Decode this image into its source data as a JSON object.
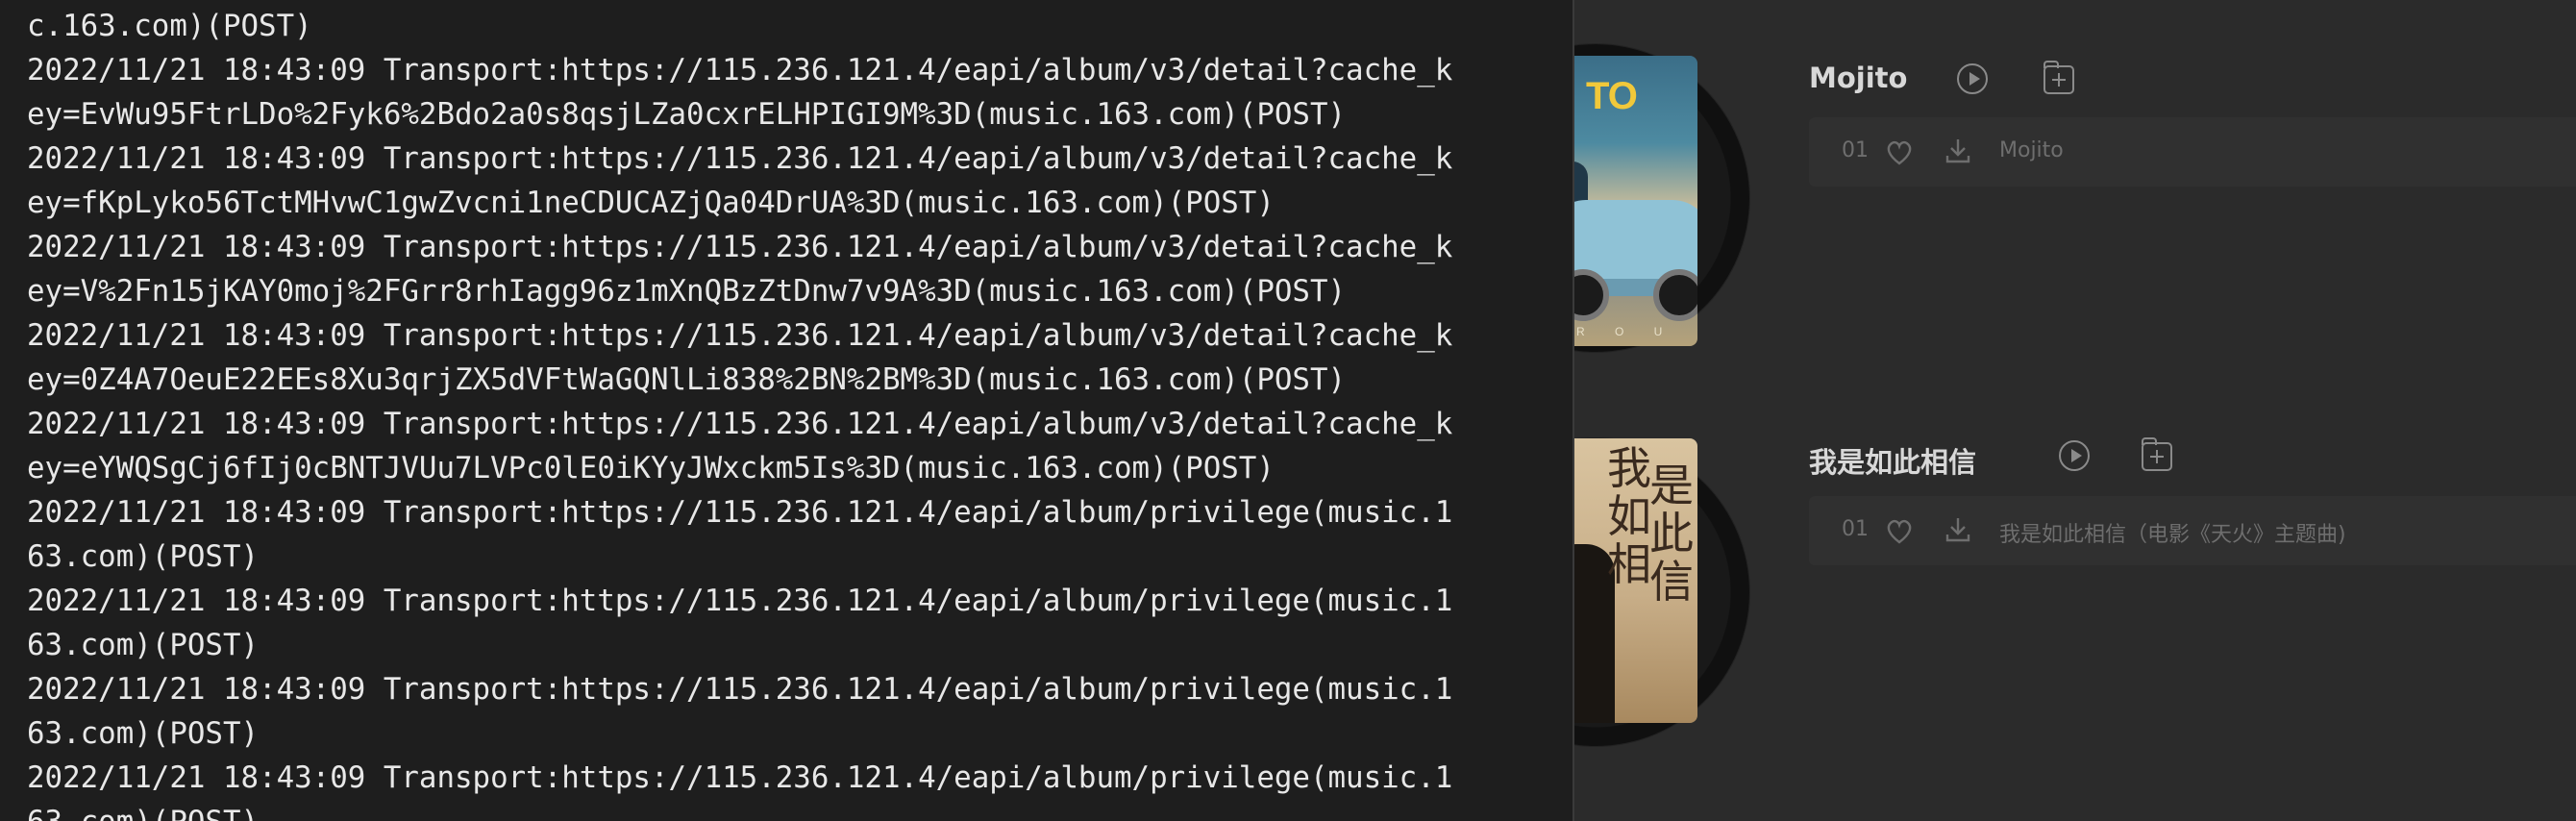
{
  "terminal": {
    "lines": [
      "c.163.com)(POST)",
      "2022/11/21 18:43:09 Transport:https://115.236.121.4/eapi/album/v3/detail?cache_k",
      "ey=EvWu95FtrLDo%2Fyk6%2Bdo2a0s8qsjLZa0cxrELHPIGI9M%3D(music.163.com)(POST)",
      "2022/11/21 18:43:09 Transport:https://115.236.121.4/eapi/album/v3/detail?cache_k",
      "ey=fKpLyko56TctMHvwC1gwZvcni1neCDUCAZjQa04DrUA%3D(music.163.com)(POST)",
      "2022/11/21 18:43:09 Transport:https://115.236.121.4/eapi/album/v3/detail?cache_k",
      "ey=V%2Fn15jKAY0moj%2FGrr8rhIagg96z1mXnQBzZtDnw7v9A%3D(music.163.com)(POST)",
      "2022/11/21 18:43:09 Transport:https://115.236.121.4/eapi/album/v3/detail?cache_k",
      "ey=0Z4A7OeuE22EEs8Xu3qrjZX5dVFtWaGQNlLi838%2BN%2BM%3D(music.163.com)(POST)",
      "2022/11/21 18:43:09 Transport:https://115.236.121.4/eapi/album/v3/detail?cache_k",
      "ey=eYWQSgCj6fIj0cBNTJVUu7LVPc0lE0iKYyJWxckm5Is%3D(music.163.com)(POST)",
      "2022/11/21 18:43:09 Transport:https://115.236.121.4/eapi/album/privilege(music.1",
      "63.com)(POST)",
      "2022/11/21 18:43:09 Transport:https://115.236.121.4/eapi/album/privilege(music.1",
      "63.com)(POST)",
      "2022/11/21 18:43:09 Transport:https://115.236.121.4/eapi/album/privilege(music.1",
      "63.com)(POST)",
      "2022/11/21 18:43:09 Transport:https://115.236.121.4/eapi/album/privilege(music.1",
      "63.com)(POST)"
    ]
  },
  "albums": [
    {
      "name": "Mojito",
      "cover_title": "TO",
      "cover_bottom": "R O U",
      "tracks": [
        {
          "number": "01",
          "title": "Mojito"
        }
      ]
    },
    {
      "name": "我是如此相信",
      "cover_text_col1": "我如相",
      "cover_text_col2": "是此信",
      "tracks": [
        {
          "number": "01",
          "title": "我是如此相信（电影《天火》主题曲)"
        }
      ]
    }
  ],
  "colors": {
    "app_background": "#2b2b2b",
    "terminal_background": "#1e1e1e",
    "terminal_text": "#e8e8e8",
    "muted_text": "#6e6e6e"
  },
  "icons": [
    "play-icon",
    "add-to-playlist-icon",
    "heart-icon",
    "download-icon"
  ]
}
